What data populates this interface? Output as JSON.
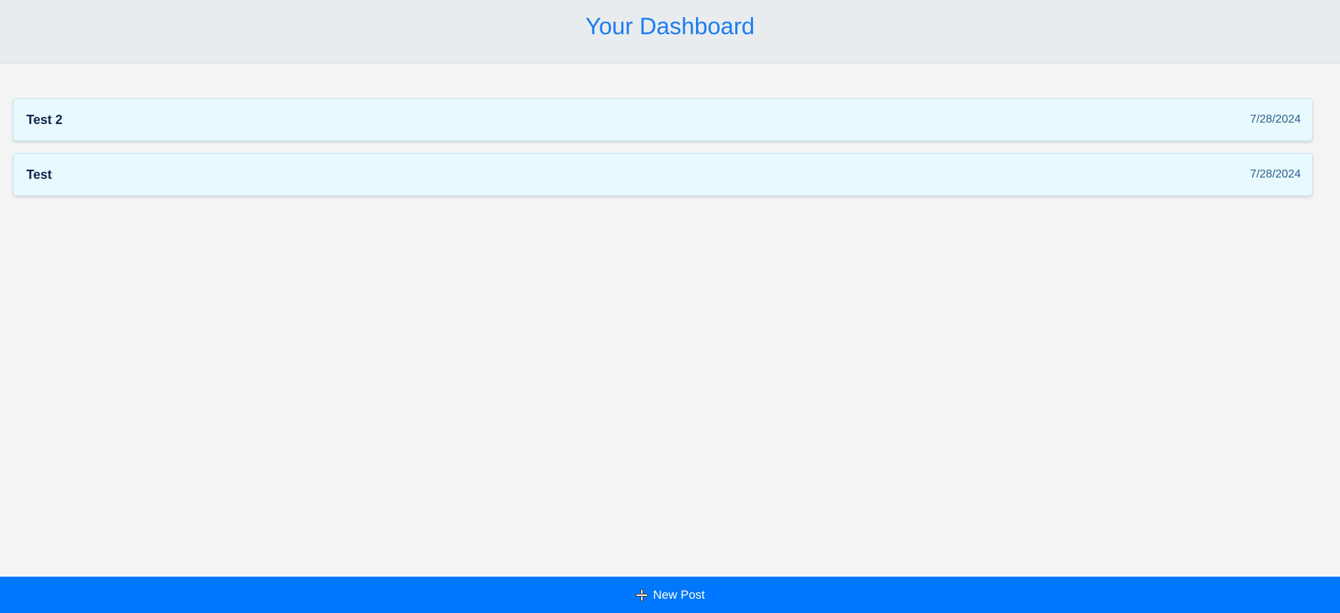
{
  "header": {
    "title": "Your Dashboard"
  },
  "posts": [
    {
      "title": "Test 2",
      "date": "7/28/2024"
    },
    {
      "title": "Test",
      "date": "7/28/2024"
    }
  ],
  "footer": {
    "new_post_label": "New Post",
    "icon": "plus-icon"
  },
  "colors": {
    "accent": "#0077ff",
    "title": "#1a7ef2",
    "card_background": "#e8f9ff"
  }
}
